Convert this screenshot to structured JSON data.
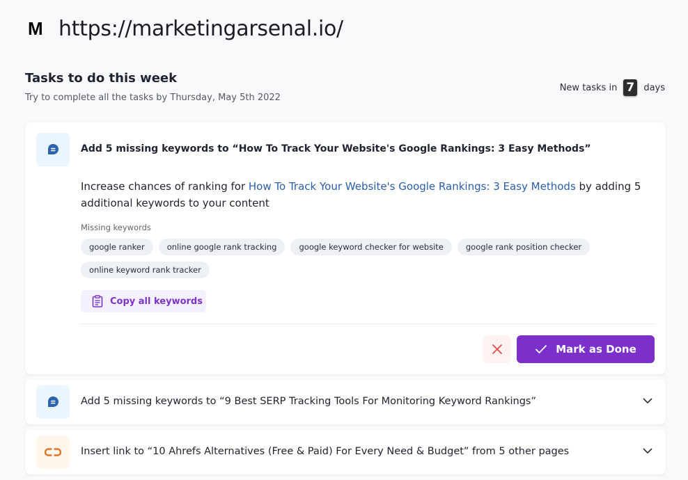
{
  "header": {
    "logo": "M",
    "site_url": "https://marketingarsenal.io/"
  },
  "section": {
    "title": "Tasks to do this week",
    "subtitle": "Try to complete all the tasks by Thursday, May 5th 2022",
    "new_tasks_prefix": "New tasks in",
    "new_tasks_days": "7",
    "new_tasks_suffix": "days"
  },
  "tasks": [
    {
      "icon": "chat-bubble-icon",
      "title": "Add 5 missing keywords to “How To Track Your Website's Google Rankings: 3 Easy Methods”",
      "expanded": true,
      "description_prefix": "Increase chances of ranking for ",
      "description_link": "How To Track Your Website's Google Rankings: 3 Easy Methods",
      "description_suffix": " by adding 5 additional keywords to your content",
      "missing_keywords_label": "Missing keywords",
      "keywords": [
        "google ranker",
        "online google rank tracking",
        "google keyword checker for website",
        "google rank position checker",
        "online keyword rank tracker"
      ],
      "copy_button": "Copy all keywords",
      "done_button": "Mark as Done"
    },
    {
      "icon": "chat-bubble-icon",
      "title": "Add 5 missing keywords to “9 Best SERP Tracking Tools For Monitoring Keyword Rankings”",
      "expanded": false
    },
    {
      "icon": "link-icon",
      "title": "Insert link to “10 Ahrefs Alternatives (Free & Paid) For Every Need & Budget” from 5 other pages",
      "expanded": false
    }
  ],
  "colors": {
    "accent": "#7b30c9",
    "link": "#2c5ea8",
    "keyword_icon": "#2a64ad",
    "link_icon": "#e5742b",
    "dismiss": "#e5484d"
  }
}
